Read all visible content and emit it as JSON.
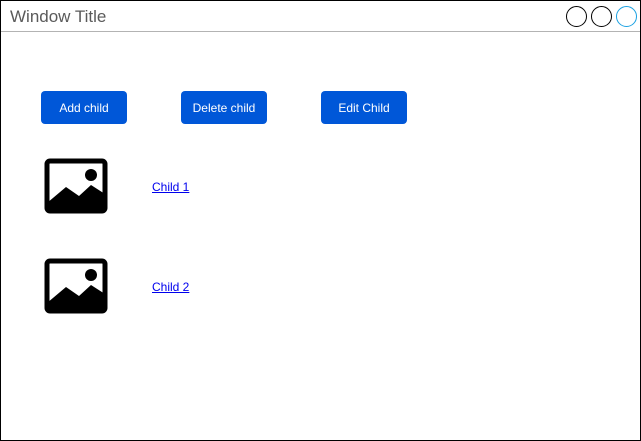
{
  "window": {
    "title": "Window Title"
  },
  "toolbar": {
    "add_label": "Add child",
    "delete_label": "Delete child",
    "edit_label": "Edit Child"
  },
  "children": [
    {
      "label": "Child 1",
      "icon": "image-icon"
    },
    {
      "label": "Child 2",
      "icon": "image-icon"
    }
  ],
  "colors": {
    "button_bg": "#0057d8",
    "button_text": "#ffffff",
    "link": "#0000ee",
    "maximize_accent": "#1ba1e2"
  }
}
